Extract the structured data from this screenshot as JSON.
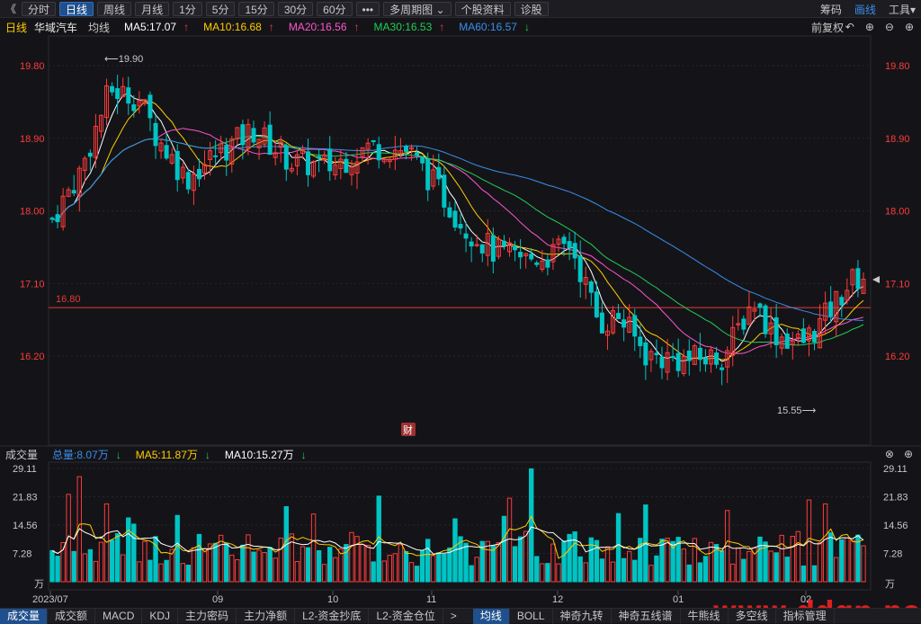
{
  "toolbar": {
    "back_icon": "double-left-arrow-icon",
    "back_glyph": "《",
    "periods": [
      "分时",
      "日线",
      "周线",
      "月线",
      "1分",
      "5分",
      "15分",
      "30分",
      "60分"
    ],
    "active_period": 1,
    "more": "•••",
    "multi_period": "多周期图",
    "stock_info": "个股资料",
    "diagnose": "诊股",
    "right": {
      "chips": "筹码",
      "draw": "画线",
      "tools": "工具"
    }
  },
  "ma_header": {
    "chart_type": "日线",
    "stock_name": "华域汽车",
    "avg_line": "均线",
    "ma5": "MA5:17.07",
    "ma10": "MA10:16.68",
    "ma20": "MA20:16.56",
    "ma30": "MA30:16.53",
    "ma60": "MA60:16.57",
    "adjust": "前复权"
  },
  "vol_header": {
    "title": "成交量",
    "total": "总量:8.07万",
    "ma5": "MA5:11.87万",
    "ma10": "MA10:15.27万"
  },
  "colors": {
    "up": "#ff3b3b",
    "down": "#00c4c4",
    "ma5": "#ffffff",
    "ma10": "#ffcc00",
    "ma20": "#ff55cc",
    "ma30": "#22cc55",
    "ma60": "#3b8eea",
    "ref": "#e53935"
  },
  "chart_data": {
    "type": "candlestick",
    "price_ticks": [
      "19.80",
      "18.90",
      "18.00",
      "17.10",
      "16.20"
    ],
    "price_values": [
      19.8,
      18.9,
      18.0,
      17.1,
      16.2
    ],
    "vol_ticks": [
      "29.11",
      "21.83",
      "14.56",
      "7.28",
      "万"
    ],
    "vol_values": [
      29.11,
      21.83,
      14.56,
      7.28
    ],
    "x_labels": [
      "2023/07",
      "09",
      "10",
      "11",
      "12",
      "01",
      "02"
    ],
    "ref_line": {
      "value": 16.8,
      "label": "16.80"
    },
    "high_mark": {
      "value": "19.90"
    },
    "low_mark": {
      "value": "15.55"
    },
    "marker_badge": "财",
    "candles_note": ""
  },
  "bottom_tabs": [
    "成交量",
    "成交额",
    "MACD",
    "KDJ",
    "主力密码",
    "主力净额",
    "L2-资金抄底",
    "L2-资金仓位",
    ">",
    "均线",
    "BOLL",
    "神奇九转",
    "神奇五线谱",
    "牛熊线",
    "多空线",
    "指标管理"
  ],
  "bottom_active": [
    0,
    9
  ],
  "watermark": "www.ddgp.net"
}
